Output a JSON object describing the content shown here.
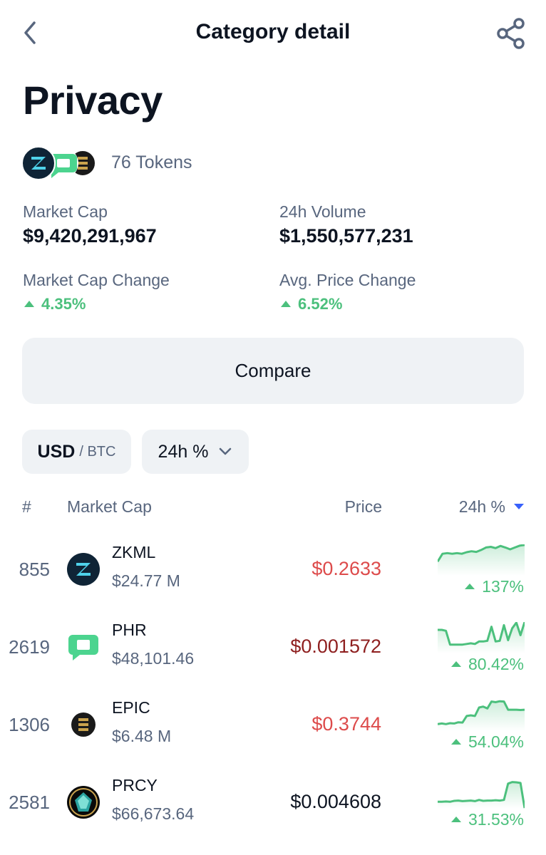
{
  "header": {
    "title": "Category detail"
  },
  "category": {
    "name": "Privacy",
    "tokens_count": "76 Tokens"
  },
  "stats": {
    "market_cap": {
      "label": "Market Cap",
      "value": "$9,420,291,967"
    },
    "volume_24h": {
      "label": "24h Volume",
      "value": "$1,550,577,231"
    },
    "market_cap_change": {
      "label": "Market Cap Change",
      "value": "4.35%"
    },
    "avg_price_change": {
      "label": "Avg. Price Change",
      "value": "6.52%"
    }
  },
  "compare": {
    "label": "Compare"
  },
  "filters": {
    "currency_active": "USD",
    "currency_alt": "/ BTC",
    "period": "24h %"
  },
  "table": {
    "headers": {
      "rank": "#",
      "market_cap": "Market Cap",
      "price": "Price",
      "change": "24h %"
    },
    "rows": [
      {
        "rank": "855",
        "symbol": "ZKML",
        "market_cap": "$24.77 M",
        "price": "$0.2633",
        "price_color": "#dd4b4b",
        "change": "137%",
        "logo": "zkml-logo",
        "spark": [
          0.55,
          0.3,
          0.28,
          0.3,
          0.28,
          0.3,
          0.25,
          0.22,
          0.24,
          0.18,
          0.1,
          0.08,
          0.12,
          0.05,
          0.1,
          0.16,
          0.1,
          0.04,
          0.02
        ]
      },
      {
        "rank": "2619",
        "symbol": "PHR",
        "market_cap": "$48,101.46",
        "price": "$0.001572",
        "price_color": "#8e1f1f",
        "change": "80.42%",
        "logo": "phr-logo",
        "spark": [
          0.25,
          0.25,
          0.28,
          0.72,
          0.72,
          0.72,
          0.72,
          0.7,
          0.68,
          0.7,
          0.62,
          0.62,
          0.6,
          0.15,
          0.62,
          0.6,
          0.1,
          0.58,
          0.2,
          0.02,
          0.42,
          0.0
        ]
      },
      {
        "rank": "1306",
        "symbol": "EPIC",
        "market_cap": "$6.48 M",
        "price": "$0.3744",
        "price_color": "#dd4b4b",
        "change": "54.04%",
        "logo": "epic-logo",
        "spark": [
          0.78,
          0.76,
          0.78,
          0.75,
          0.76,
          0.72,
          0.73,
          0.52,
          0.5,
          0.52,
          0.25,
          0.22,
          0.28,
          0.06,
          0.08,
          0.05,
          0.06,
          0.32,
          0.32,
          0.32,
          0.33,
          0.32
        ]
      },
      {
        "rank": "2581",
        "symbol": "PRCY",
        "market_cap": "$66,673.64",
        "price": "$0.004608",
        "price_color": "#0d1421",
        "change": "31.53%",
        "logo": "prcy-logo",
        "spark": [
          0.78,
          0.78,
          0.77,
          0.78,
          0.75,
          0.74,
          0.76,
          0.75,
          0.74,
          0.76,
          0.72,
          0.75,
          0.74,
          0.74,
          0.73,
          0.74,
          0.72,
          0.2,
          0.15,
          0.16,
          0.18,
          0.98
        ]
      }
    ]
  },
  "colors": {
    "positive": "#4cc07d",
    "negative": "#dd4b4b",
    "accent": "#3861fb",
    "muted": "#58667e",
    "surface": "#eff2f5"
  },
  "icons": {
    "back": "chevron-left-icon",
    "share": "share-icon",
    "dropdown": "chevron-down-icon"
  }
}
